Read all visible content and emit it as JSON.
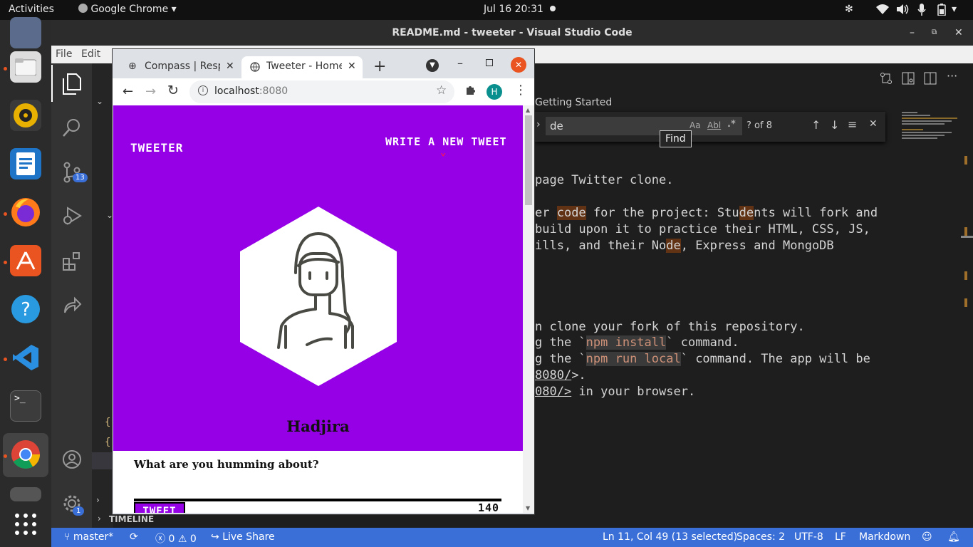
{
  "topbar": {
    "activities": "Activities",
    "app_name": "Google Chrome",
    "clock": "Jul 16  20:31"
  },
  "dock": {
    "apps": [
      "thunderbird-icon",
      "files-icon",
      "rhythmbox-icon",
      "writer-icon",
      "firefox-icon",
      "software-icon",
      "help-icon",
      "vscode-icon",
      "terminal-icon",
      "chrome-icon",
      "disk-icon",
      "apps-grid-icon"
    ]
  },
  "vscode": {
    "window_title": "README.md - tweeter - Visual Studio Code",
    "menu": [
      "File",
      "Edit"
    ],
    "tab_label": "Getting Started",
    "find": {
      "value": "de",
      "result": "? of 8",
      "tooltip": "Find",
      "opt_case": "Aa",
      "opt_word": "Abl",
      "opt_regex": ".*"
    },
    "badges": {
      "scm": "13",
      "settings": "1"
    },
    "timeline_label": "TIMELINE",
    "code": {
      "l1": "page Twitter clone.",
      "l2a": "er ",
      "l2b": "code",
      "l2c": " for the project: Stu",
      "l2d": "de",
      "l2e": "nts will fork and",
      "l3": "build upon it to practice their HTML, CSS, JS,",
      "l4a": "ills, and their No",
      "l4b": "de",
      "l4c": ", Express and MongoDB",
      "l5": "n clone your fork of this repository.",
      "l6a": "g the `",
      "l6b": "npm install",
      "l6c": "` command.",
      "l7a": "g the `",
      "l7b": "npm run local",
      "l7c": "` command. The app will be",
      "l8": "8080/",
      "l8b": ">.",
      "l9": "080/>",
      "l9b": " in your browser."
    },
    "status": {
      "branch": "master*",
      "errors": "0",
      "warnings": "0",
      "live_share": "Live Share",
      "position": "Ln 11, Col 49 (13 selected)",
      "spaces": "Spaces: 2",
      "encoding": "UTF-8",
      "eol": "LF",
      "language": "Markdown"
    }
  },
  "chrome": {
    "tabs": [
      {
        "label": "Compass | Resp"
      },
      {
        "label": "Tweeter - Home"
      }
    ],
    "url_host": "localhost",
    "url_port": ":8080",
    "profile_initial": "H"
  },
  "tweeter": {
    "brand": "TWEETER",
    "write_new": "WRITE A NEW TWEET",
    "user_name": "Hadjira",
    "compose_label": "What are you humming about?",
    "tweet_button": "TWEET",
    "counter": "140",
    "colors": {
      "header_bg": "#9600e6",
      "white": "#ffffff",
      "accent_red": "#ff1a4a"
    }
  }
}
